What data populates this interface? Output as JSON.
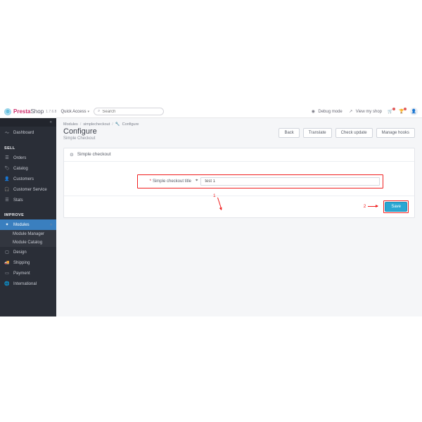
{
  "brand": {
    "pre": "Presta",
    "suf": "Shop",
    "version": "1.7.6.8"
  },
  "quick_access": "Quick Access",
  "search": {
    "placeholder": "Search"
  },
  "topRight": {
    "debug": "Debug mode",
    "view": "View my shop"
  },
  "sidebar": {
    "dashboard": "Dashboard",
    "sell_head": "SELL",
    "orders": "Orders",
    "catalog": "Catalog",
    "customers": "Customers",
    "customer_service": "Customer Service",
    "stats": "Stats",
    "improve_head": "IMPROVE",
    "modules": "Modules",
    "module_manager": "Module Manager",
    "module_catalog": "Module Catalog",
    "design": "Design",
    "shipping": "Shipping",
    "payment": "Payment",
    "international": "International"
  },
  "crumbs": {
    "a": "Modules",
    "b": "simplecheckout",
    "c": "Configure"
  },
  "page": {
    "title": "Configure",
    "subtitle": "Simple Checkout"
  },
  "actions": {
    "back": "Back",
    "translate": "Translate",
    "check": "Check update",
    "hooks": "Manage hooks"
  },
  "panel": {
    "title": "Simple checkout"
  },
  "form": {
    "label": "Simple checkout title",
    "value": "test 1"
  },
  "save": "Save",
  "anno": {
    "one": "1",
    "two": "2"
  }
}
